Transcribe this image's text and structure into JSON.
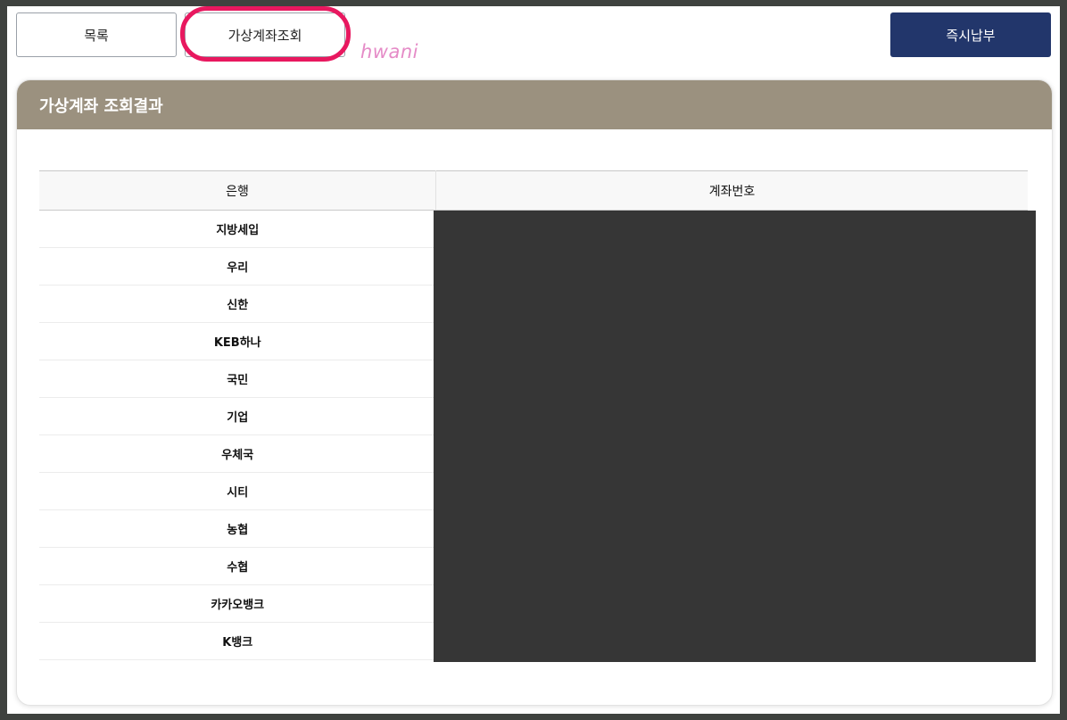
{
  "toolbar": {
    "list_label": "목록",
    "virtual_account_label": "가상계좌조회",
    "pay_now_label": "즉시납부",
    "watermark": "hwani"
  },
  "panel": {
    "title": "가상계좌 조회결과"
  },
  "table": {
    "columns": [
      "은행",
      "계좌번호"
    ],
    "rows": [
      {
        "bank": "지방세입"
      },
      {
        "bank": "우리"
      },
      {
        "bank": "신한"
      },
      {
        "bank": "KEB하나"
      },
      {
        "bank": "국민"
      },
      {
        "bank": "기업"
      },
      {
        "bank": "우체국"
      },
      {
        "bank": "시티"
      },
      {
        "bank": "농협"
      },
      {
        "bank": "수협"
      },
      {
        "bank": "카카오뱅크"
      },
      {
        "bank": "K뱅크"
      }
    ]
  },
  "colors": {
    "highlight": "#e8185f",
    "header_bg": "#9b917f",
    "pay_button_bg": "#22366b",
    "redaction": "#363636"
  }
}
